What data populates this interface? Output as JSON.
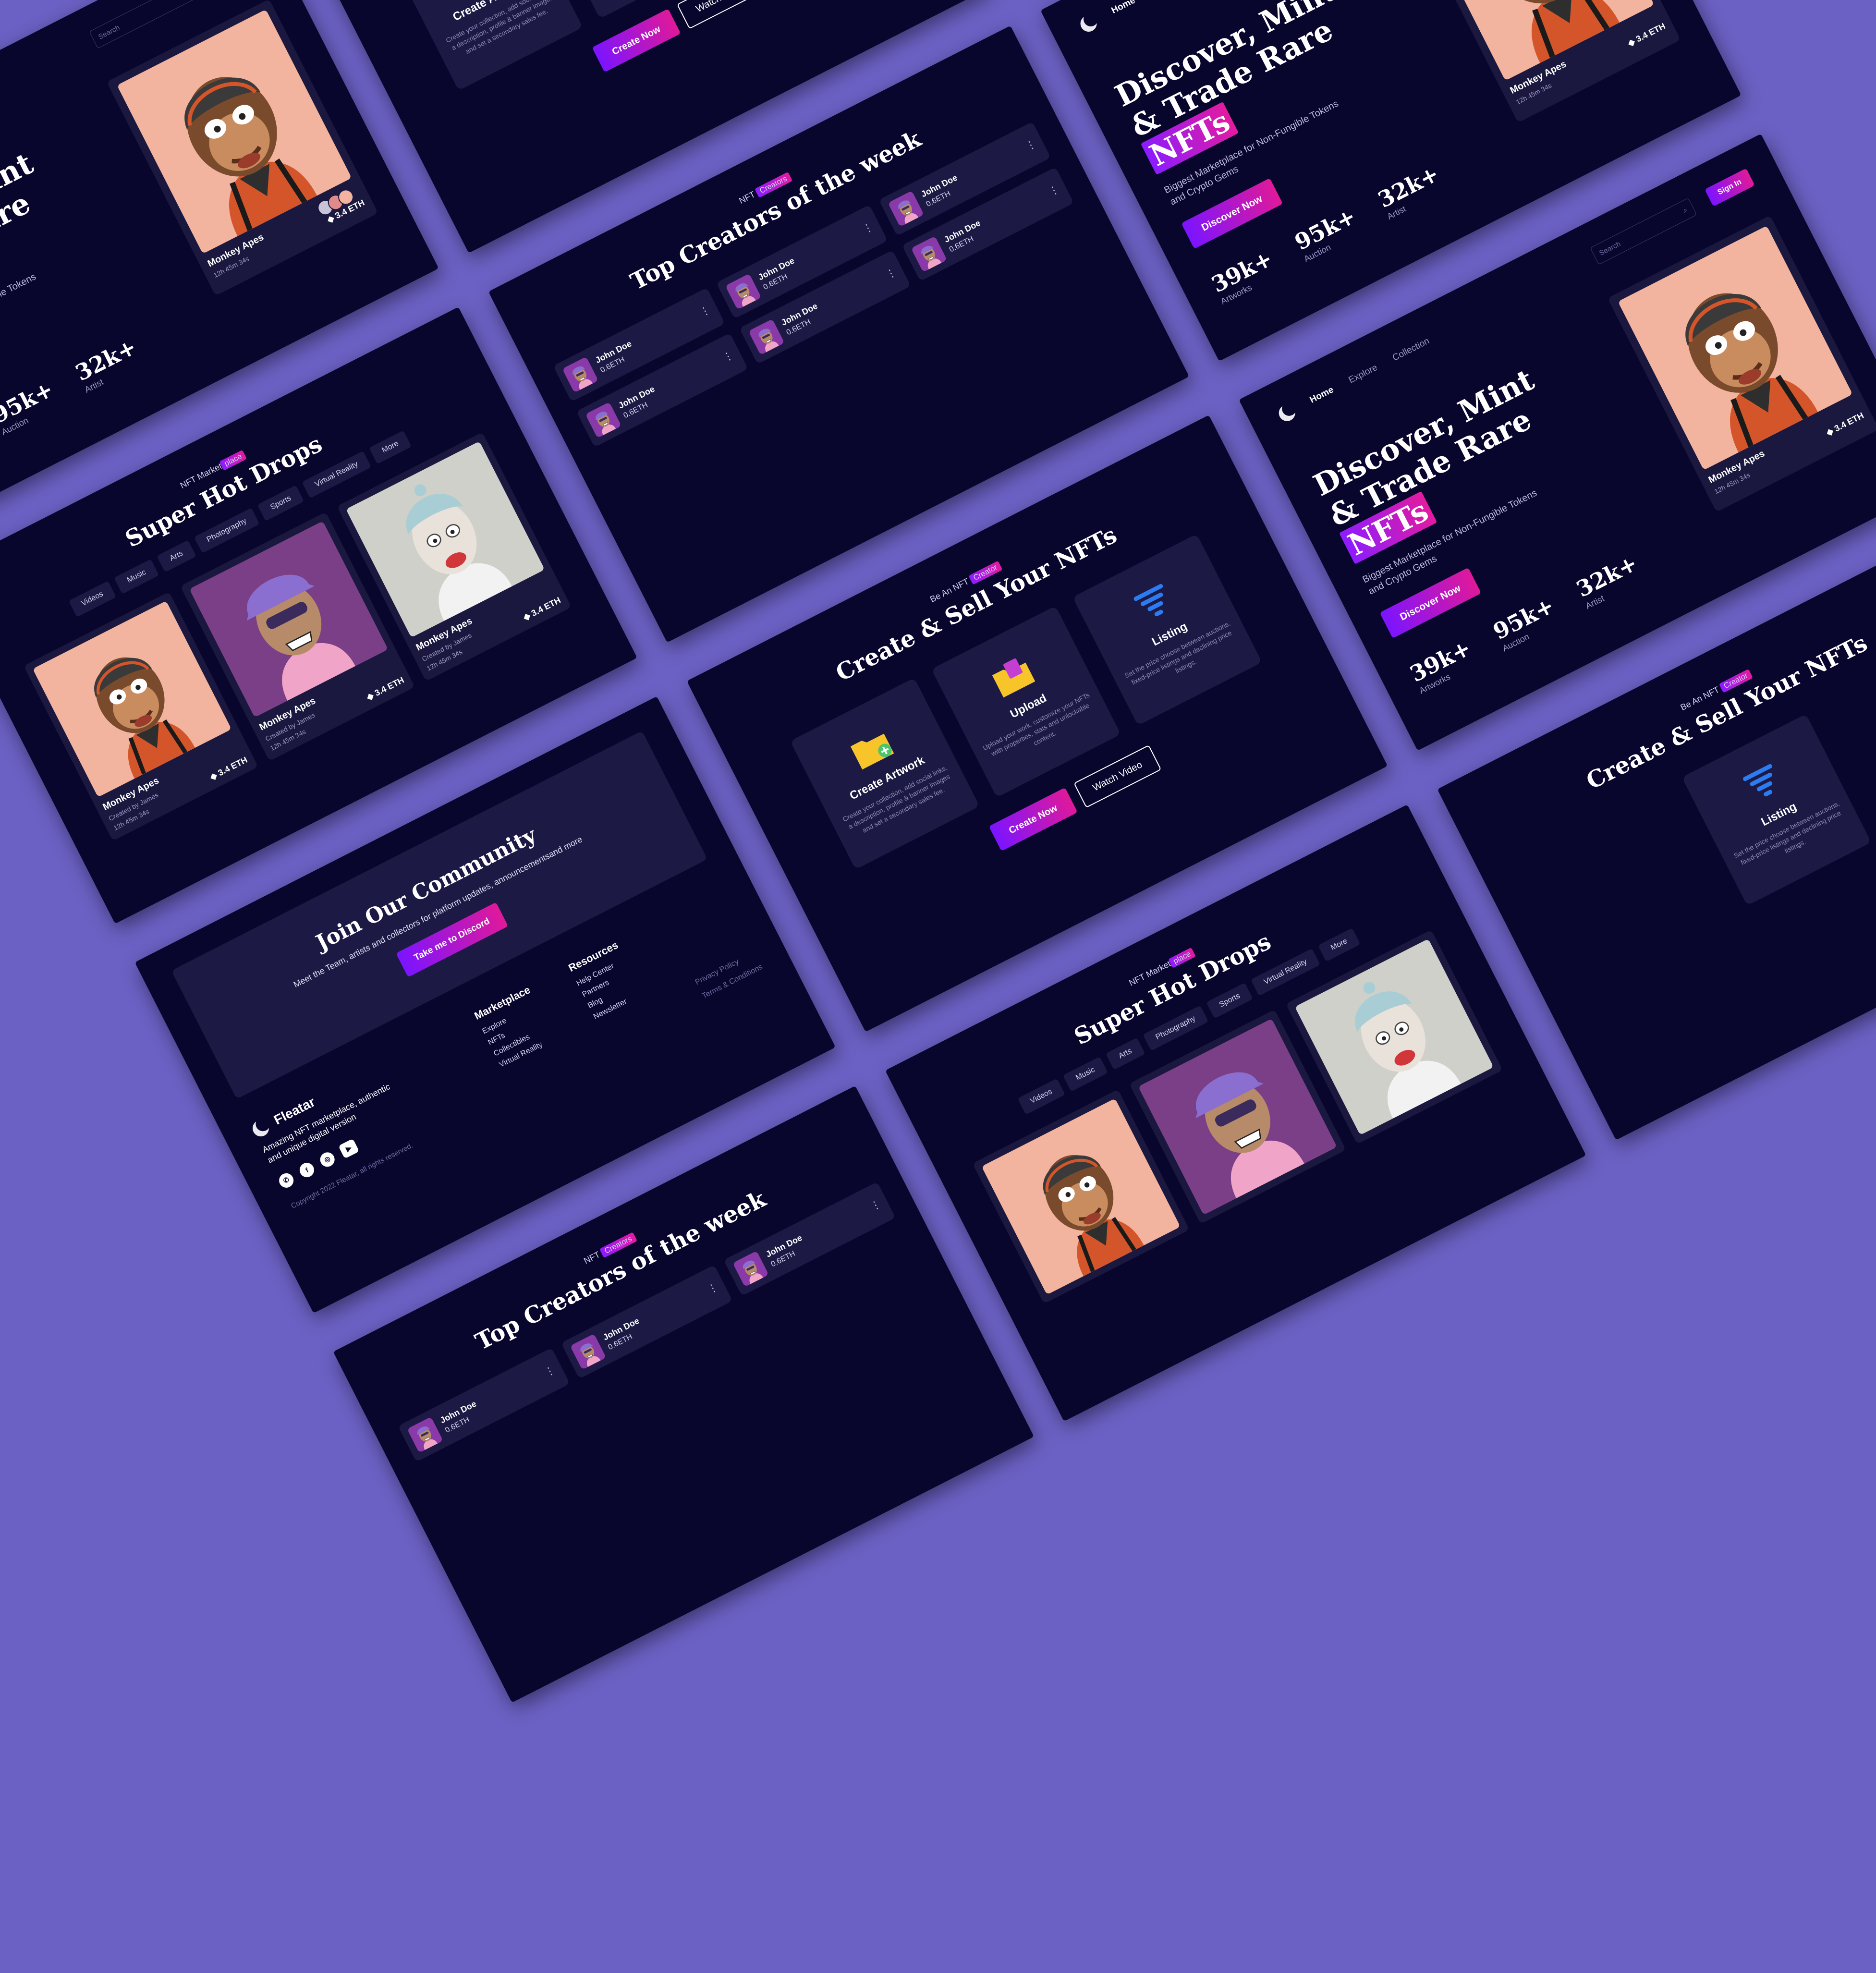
{
  "hero": {
    "nav": [
      "Home",
      "Explore",
      "Collection"
    ],
    "search_placeholder": "Search",
    "sign_in": "Sign In",
    "title_line1": "Discover, Mint",
    "title_line2": "& Trade Rare",
    "title_highlight": "NFTs",
    "subtitle": "Biggest Marketplace for Non-Fungible Tokens and Crypto Gems",
    "cta": "Discover Now",
    "stats": [
      {
        "value": "39k+",
        "label": "Artworks"
      },
      {
        "value": "95k+",
        "label": "Auction"
      },
      {
        "value": "32k+",
        "label": "Artist"
      }
    ],
    "card": {
      "name": "Monkey Apes",
      "meta": "12h 45m 34s",
      "price": "3.4 ETH"
    }
  },
  "create": {
    "eyebrow": "Be An NFT",
    "eyebrow_highlight": "Creator",
    "title": "Create & Sell Your NFTs",
    "features": [
      {
        "icon": "folder-plus-icon",
        "name": "Create Artwork",
        "text": "Create your collection, add social links, a description, profile & banner images and set a secondary sales fee."
      },
      {
        "icon": "upload-icon",
        "name": "Upload",
        "text": "Upload your work, customize your NFTs with properties, stats and unlockable content."
      },
      {
        "icon": "listing-icon",
        "name": "Listing",
        "text": "Set the price choose between auctions, fixed-price listings and declining price listings."
      }
    ],
    "create_btn": "Create Now",
    "watch_btn": "Watch Video"
  },
  "community": {
    "title": "Join Our Community",
    "text": "Meet the Team, artists and collectors for platform updates, announcementsand more",
    "cta": "Take me to Discord",
    "brand": "Fleatar",
    "brand_desc": "Amazing NFT marketplace, authentic and unique digital version",
    "copyright": "Copyright 2022 Fleatar, all rights reserved.",
    "marketplace_title": "Marketplace",
    "marketplace_links": [
      "Explore",
      "NFTs",
      "Collectibles",
      "Virtual Reality"
    ],
    "resources_title": "Resources",
    "resources_links": [
      "Help Center",
      "Partners",
      "Blog",
      "Newsletter"
    ],
    "legal": [
      "Privacy Policy",
      "Terms & Conditions"
    ]
  },
  "drops": {
    "eyebrow": "NFT Market",
    "eyebrow_highlight": "place",
    "title": "Super Hot Drops",
    "filters": [
      "Videos",
      "Music",
      "Arts",
      "Photography",
      "Sports",
      "Virtual Reality",
      "More"
    ],
    "cards": [
      {
        "name": "Monkey Apes",
        "creator": "Created by James",
        "meta": "12h 45m 34s",
        "price": "3.4 ETH"
      },
      {
        "name": "Monkey Apes",
        "creator": "Created by James",
        "meta": "12h 45m 34s",
        "price": "3.4 ETH"
      },
      {
        "name": "Monkey Apes",
        "creator": "Created by James",
        "meta": "12h 45m 34s",
        "price": "3.4 ETH"
      }
    ]
  },
  "creators": {
    "eyebrow": "NFT",
    "eyebrow_highlight": "Creators",
    "title": "Top Creators of the week",
    "list": [
      {
        "name": "John Doe",
        "eth": "0.6ETH"
      },
      {
        "name": "John Doe",
        "eth": "0.6ETH"
      },
      {
        "name": "John Doe",
        "eth": "0.6ETH"
      },
      {
        "name": "John Doe",
        "eth": "0.6ETH"
      },
      {
        "name": "John Doe",
        "eth": "0.6ETH"
      },
      {
        "name": "John Doe",
        "eth": "0.6ETH"
      }
    ]
  },
  "colors": {
    "background": "#6b61c4",
    "panel": "#09062e",
    "accent_start": "#7b14ff",
    "accent_end": "#e0199a"
  }
}
